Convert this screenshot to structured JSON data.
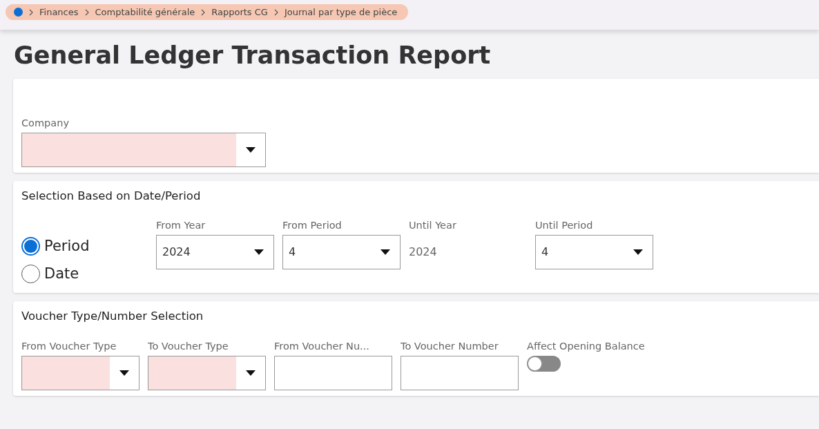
{
  "breadcrumb": [
    "Finances",
    "Comptabilité générale",
    "Rapports CG",
    "Journal par type de pièce"
  ],
  "title": "General Ledger Transaction Report",
  "sections": [
    {
      "fields": [
        {
          "kind": "select",
          "label": "Company",
          "required": true,
          "wide": true
        }
      ]
    },
    {
      "heading": "Selection Based on Date/Period",
      "radios": [
        {
          "label": "Period",
          "selected": true
        },
        {
          "label": "Date",
          "selected": false
        }
      ],
      "fields": [
        {
          "kind": "select",
          "label": "From Year",
          "value": "2024",
          "required": false
        },
        {
          "kind": "select",
          "label": "From Period",
          "value": "4",
          "required": false
        },
        {
          "kind": "text",
          "label": "Until Year",
          "value": "2024"
        },
        {
          "kind": "select",
          "label": "Until Period",
          "value": "4",
          "required": false
        }
      ]
    },
    {
      "heading": "Voucher Type/Number Selection",
      "fields": [
        {
          "kind": "select",
          "label": "From Voucher Type",
          "required": true
        },
        {
          "kind": "select",
          "label": "To Voucher Type",
          "required": true
        },
        {
          "kind": "input",
          "label": "From Voucher Nu..."
        },
        {
          "kind": "input",
          "label": "To Voucher Number"
        },
        {
          "kind": "toggle",
          "label": "Affect Opening Balance",
          "on": false
        }
      ]
    }
  ]
}
